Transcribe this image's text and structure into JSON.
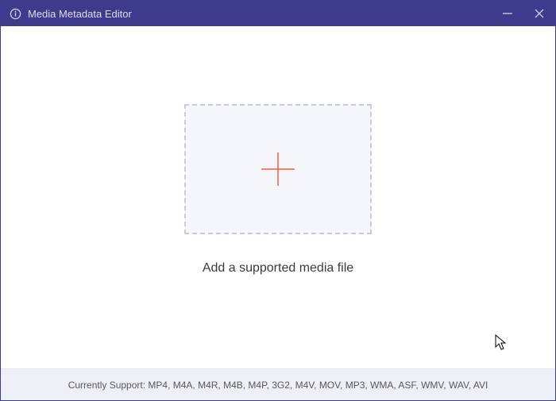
{
  "titlebar": {
    "title": "Media Metadata Editor"
  },
  "main": {
    "prompt": "Add a supported media file"
  },
  "footer": {
    "text": "Currently Support: MP4, M4A, M4R, M4B, M4P, 3G2, M4V, MOV, MP3, WMA, ASF, WMV, WAV, AVI"
  }
}
